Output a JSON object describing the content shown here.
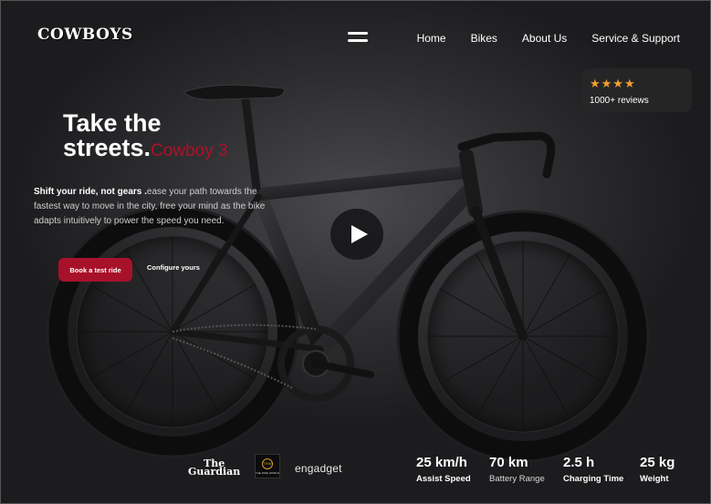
{
  "brand": {
    "logo": "COWBOYS"
  },
  "nav": {
    "items": [
      "Home",
      "Bikes",
      "About Us",
      "Service & Support"
    ]
  },
  "rating": {
    "stars": "★★★★",
    "reviews": "1000+ reviews"
  },
  "hero": {
    "headline_line1": "Take the",
    "headline_line2": "streets.",
    "model": "Cowboy 3",
    "sub_bold": "Shift your ride, not gears .",
    "sub_text": "ease your path towards the fastest way to move in the city, free your mind as the bike adapts intuitively to power the speed you need.",
    "cta_primary": "Book a test ride",
    "cta_secondary": "Configure yours"
  },
  "press": {
    "guardian_line1": "The",
    "guardian_line2": "Guardian",
    "trw_mark": "TRW",
    "trw_caption": "THE RIDE WORLD",
    "engadget": "engadget"
  },
  "specs": [
    {
      "value": "25 km/h",
      "label": "Assist Speed"
    },
    {
      "value": "70 km",
      "label": "Battery Range"
    },
    {
      "value": "2.5 h",
      "label": "Charging Time"
    },
    {
      "value": "25 kg",
      "label": "Weight"
    }
  ],
  "colors": {
    "accent": "#a8112a",
    "star": "#f0a030",
    "background": "#1c1c1e"
  }
}
